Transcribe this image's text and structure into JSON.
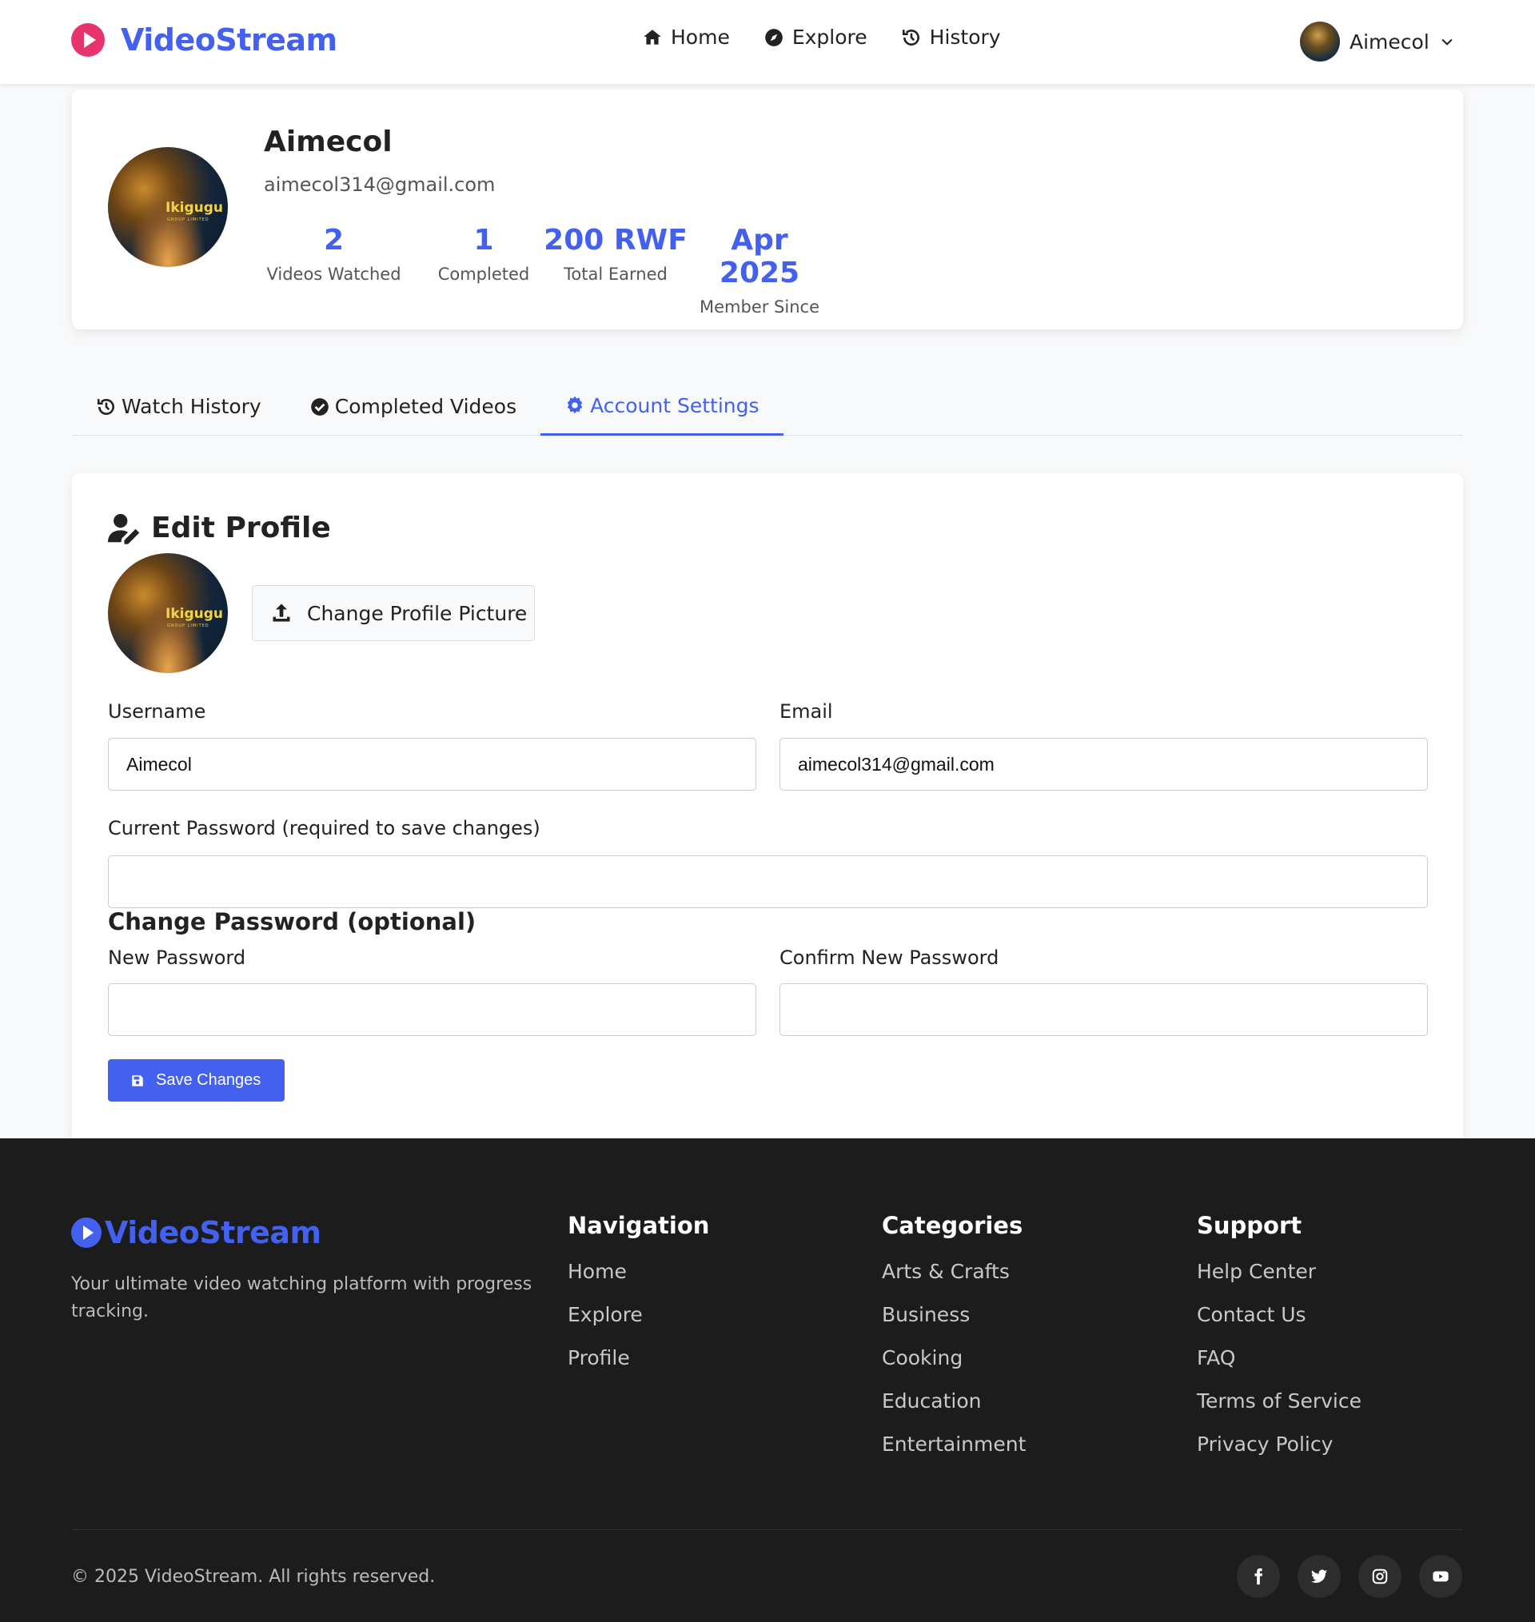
{
  "brand": {
    "name": "VideoStream",
    "accent": "#4361ee",
    "logo_color": "#e8346d"
  },
  "nav": [
    {
      "label": "Home",
      "icon": "home-icon"
    },
    {
      "label": "Explore",
      "icon": "compass-icon"
    },
    {
      "label": "History",
      "icon": "history-icon"
    }
  ],
  "user_menu": {
    "name": "Aimecol",
    "icon": "chevron-down-icon"
  },
  "profile": {
    "name": "Aimecol",
    "email": "aimecol314@gmail.com",
    "avatar_brand": "Ikigugu",
    "avatar_sub": "GROUP LIMITED",
    "stats": [
      {
        "value": "2",
        "label": "Videos Watched"
      },
      {
        "value": "1",
        "label": "Completed"
      },
      {
        "value": "200 RWF",
        "label": "Total Earned"
      },
      {
        "value": "Apr 2025",
        "label": "Member Since"
      }
    ]
  },
  "tabs": [
    {
      "label": "Watch History",
      "icon": "history-icon",
      "active": false
    },
    {
      "label": "Completed Videos",
      "icon": "check-circle-icon",
      "active": false
    },
    {
      "label": "Account Settings",
      "icon": "gear-icon",
      "active": true
    }
  ],
  "settings": {
    "title": "Edit Profile",
    "change_picture_label": "Change Profile Picture",
    "username_label": "Username",
    "username_value": "Aimecol",
    "email_label": "Email",
    "email_value": "aimecol314@gmail.com",
    "current_password_label": "Current Password (required to save changes)",
    "current_password_value": "",
    "change_password_heading": "Change Password (optional)",
    "new_password_label": "New Password",
    "new_password_value": "",
    "confirm_password_label": "Confirm New Password",
    "confirm_password_value": "",
    "save_label": "Save Changes"
  },
  "footer": {
    "brand": "VideoStream",
    "description": "Your ultimate video watching platform with progress tracking.",
    "columns": [
      {
        "title": "Navigation",
        "links": [
          "Home",
          "Explore",
          "Profile"
        ]
      },
      {
        "title": "Categories",
        "links": [
          "Arts & Crafts",
          "Business",
          "Cooking",
          "Education",
          "Entertainment"
        ]
      },
      {
        "title": "Support",
        "links": [
          "Help Center",
          "Contact Us",
          "FAQ",
          "Terms of Service",
          "Privacy Policy"
        ]
      }
    ],
    "copyright": "© 2025 VideoStream. All rights reserved.",
    "socials": [
      "facebook-icon",
      "twitter-icon",
      "instagram-icon",
      "youtube-icon"
    ]
  }
}
